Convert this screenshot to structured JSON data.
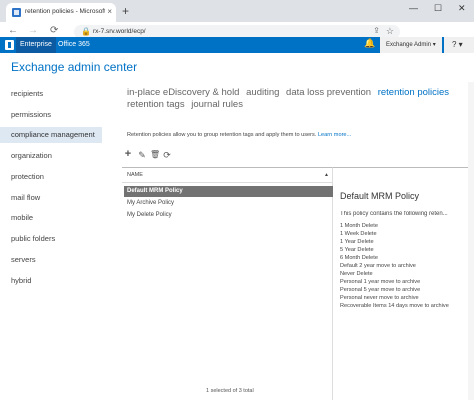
{
  "browser": {
    "tab_title": "retention policies - Microsoft Ex",
    "tab_close": "×",
    "new_tab": "+",
    "minimize": "—",
    "maximize": "☐",
    "close": "✕",
    "back": "←",
    "forward": "→",
    "reload": "⟳",
    "lock_icon": "🔒",
    "url": "rx-7.srv.world/ecp/",
    "share_icon": "⇪",
    "star_icon": "☆"
  },
  "topbar": {
    "envs": [
      "Enterprise",
      "Office 365"
    ],
    "bell_icon": "🔔",
    "user_menu": "Exchange Admin ▾",
    "help": "? ▾"
  },
  "app_title": "Exchange admin center",
  "nav": {
    "items": [
      "recipients",
      "permissions",
      "compliance management",
      "organization",
      "protection",
      "mail flow",
      "mobile",
      "public folders",
      "servers",
      "hybrid"
    ],
    "active_index": 2
  },
  "subnav": {
    "line1": [
      "in-place eDiscovery & hold",
      "auditing",
      "data loss prevention",
      "retention policies"
    ],
    "line2": [
      "retention tags",
      "journal rules"
    ],
    "current": "retention policies"
  },
  "description": {
    "text": "Retention policies allow you to group retention tags and apply them to users.",
    "link": "Learn more..."
  },
  "actions": {
    "add": "+",
    "edit": "✎",
    "delete": "🗑",
    "refresh": "⟳"
  },
  "list": {
    "column": "NAME",
    "sort_icon": "▲",
    "rows": [
      "Default MRM Policy",
      "My Archive Policy",
      "My Delete Policy"
    ],
    "selected_index": 0,
    "count": "1 selected of 3 total"
  },
  "detail": {
    "title": "Default MRM Policy",
    "intro": "This policy contains the following reten...",
    "tags": [
      "1 Month Delete",
      "1 Week Delete",
      "1 Year Delete",
      "5 Year Delete",
      "6 Month Delete",
      "Default 2 year move to archive",
      "Never Delete",
      "Personal 1 year move to archive",
      "Personal 5 year move to archive",
      "Personal never move to archive",
      "Recoverable Items 14 days move to archive"
    ]
  }
}
